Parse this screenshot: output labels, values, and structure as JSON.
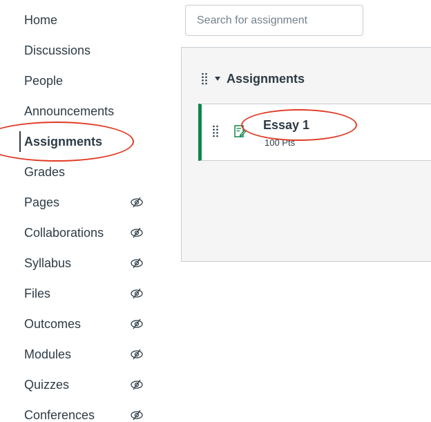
{
  "nav": {
    "items": [
      {
        "label": "Home",
        "hidden": false,
        "active": false
      },
      {
        "label": "Discussions",
        "hidden": false,
        "active": false
      },
      {
        "label": "People",
        "hidden": false,
        "active": false
      },
      {
        "label": "Announcements",
        "hidden": false,
        "active": false
      },
      {
        "label": "Assignments",
        "hidden": false,
        "active": true
      },
      {
        "label": "Grades",
        "hidden": false,
        "active": false
      },
      {
        "label": "Pages",
        "hidden": true,
        "active": false
      },
      {
        "label": "Collaborations",
        "hidden": true,
        "active": false
      },
      {
        "label": "Syllabus",
        "hidden": true,
        "active": false
      },
      {
        "label": "Files",
        "hidden": true,
        "active": false
      },
      {
        "label": "Outcomes",
        "hidden": true,
        "active": false
      },
      {
        "label": "Modules",
        "hidden": true,
        "active": false
      },
      {
        "label": "Quizzes",
        "hidden": true,
        "active": false
      },
      {
        "label": "Conferences",
        "hidden": true,
        "active": false
      }
    ]
  },
  "search": {
    "placeholder": "Search for assignment",
    "value": ""
  },
  "group": {
    "title": "Assignments",
    "assignments": [
      {
        "title": "Essay 1",
        "points": "100 Pts"
      }
    ]
  },
  "colors": {
    "text": "#2D3B45",
    "published": "#0B874B",
    "annotation": "#e03a24"
  },
  "icons": {
    "hidden": "eye-slash-icon",
    "drag": "drag-handle-icon",
    "assignment": "assignment-icon",
    "collapse": "caret-down-icon"
  }
}
